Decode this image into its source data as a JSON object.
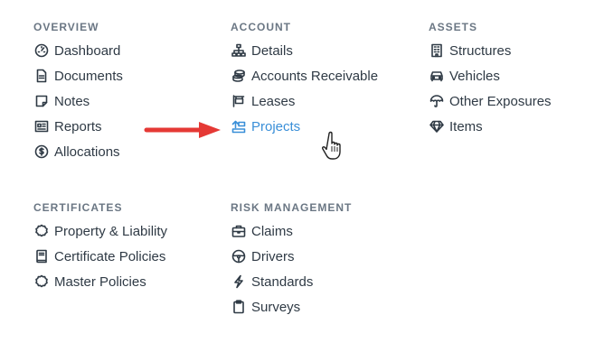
{
  "overview": {
    "title": "OVERVIEW",
    "items": [
      {
        "label": "Dashboard",
        "icon": "dashboard-icon"
      },
      {
        "label": "Documents",
        "icon": "document-icon"
      },
      {
        "label": "Notes",
        "icon": "note-icon"
      },
      {
        "label": "Reports",
        "icon": "report-icon"
      },
      {
        "label": "Allocations",
        "icon": "dollar-circle-icon"
      }
    ]
  },
  "account": {
    "title": "ACCOUNT",
    "items": [
      {
        "label": "Details",
        "icon": "sitemap-icon"
      },
      {
        "label": "Accounts Receivable",
        "icon": "coins-icon"
      },
      {
        "label": "Leases",
        "icon": "sign-icon"
      },
      {
        "label": "Projects",
        "icon": "projects-icon",
        "active": true
      }
    ]
  },
  "assets": {
    "title": "ASSETS",
    "items": [
      {
        "label": "Structures",
        "icon": "building-icon"
      },
      {
        "label": "Vehicles",
        "icon": "car-icon"
      },
      {
        "label": "Other Exposures",
        "icon": "umbrella-icon"
      },
      {
        "label": "Items",
        "icon": "gem-icon"
      }
    ]
  },
  "certificates": {
    "title": "CERTIFICATES",
    "items": [
      {
        "label": "Property & Liability",
        "icon": "certificate-icon"
      },
      {
        "label": "Certificate Policies",
        "icon": "book-icon"
      },
      {
        "label": "Master Policies",
        "icon": "certificate-icon"
      }
    ]
  },
  "risk": {
    "title": "RISK MANAGEMENT",
    "items": [
      {
        "label": "Claims",
        "icon": "briefcase-icon"
      },
      {
        "label": "Drivers",
        "icon": "steering-wheel-icon"
      },
      {
        "label": "Standards",
        "icon": "bolt-icon"
      },
      {
        "label": "Surveys",
        "icon": "clipboard-icon"
      }
    ]
  },
  "colors": {
    "text": "#2f3a45",
    "section_title": "#6b7784",
    "active": "#3a8fd8",
    "arrow": "#e53935"
  }
}
